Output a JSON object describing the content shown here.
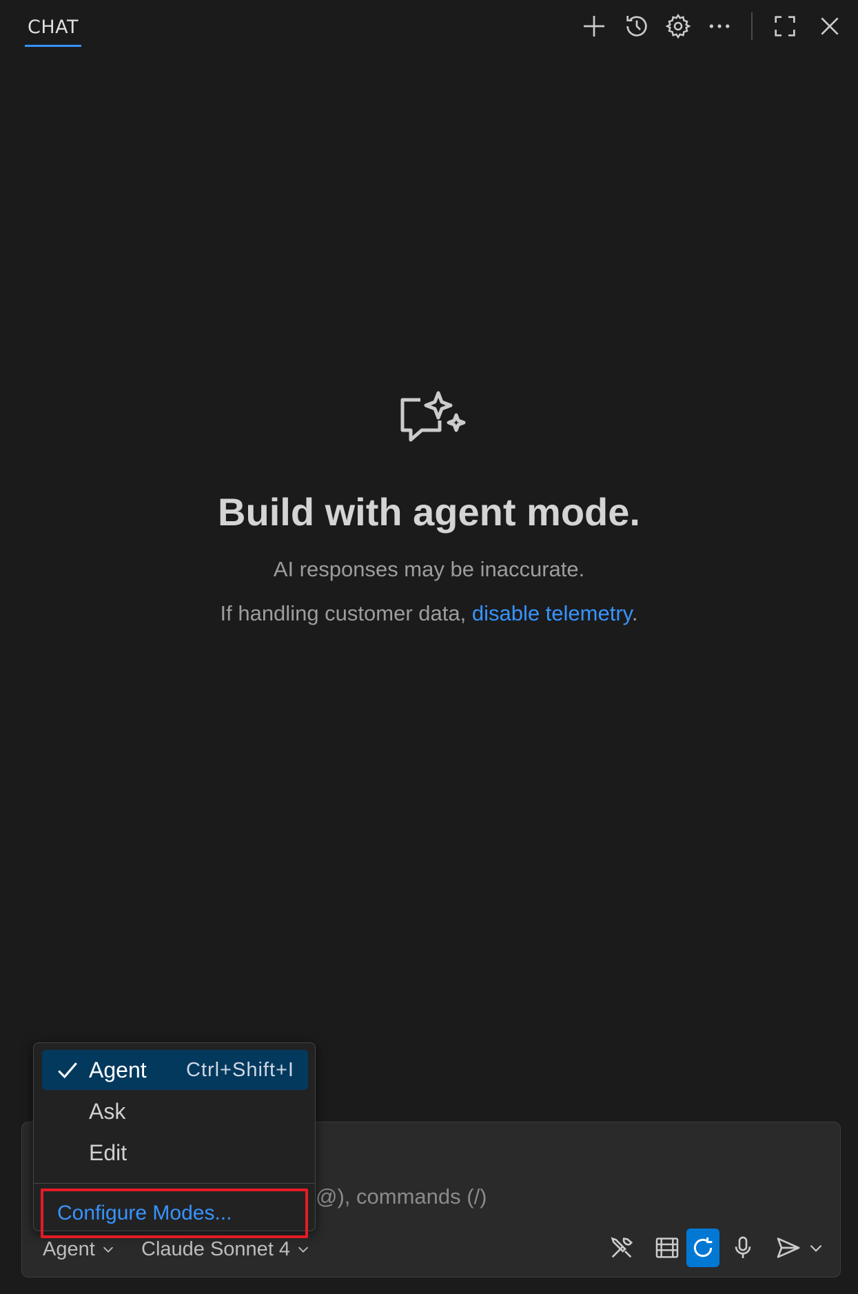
{
  "header": {
    "tab_label": "CHAT",
    "actions": [
      "plus-icon",
      "history-icon",
      "gear-icon",
      "more-icon",
      "maximize-icon",
      "close-icon"
    ]
  },
  "welcome": {
    "title": "Build with agent mode.",
    "subtitle": "AI responses may be inaccurate.",
    "telemetry_prefix": "If handling customer data, ",
    "telemetry_link": "disable telemetry",
    "telemetry_suffix": "."
  },
  "input": {
    "placeholder_visible": "@), commands (/)"
  },
  "toolbar": {
    "mode_picker": "Agent",
    "model_picker": "Claude Sonnet 4",
    "icons": [
      "tools-icon",
      "context-icon",
      "refresh-icon",
      "microphone-icon",
      "send-icon",
      "chevron-down-icon"
    ]
  },
  "mode_menu": {
    "items": [
      {
        "label": "Agent",
        "shortcut": "Ctrl+Shift+I",
        "selected": true
      },
      {
        "label": "Ask",
        "shortcut": "",
        "selected": false
      },
      {
        "label": "Edit",
        "shortcut": "",
        "selected": false
      }
    ],
    "configure": "Configure Modes..."
  },
  "colors": {
    "background": "#1b1b1c",
    "accent": "#3794ff",
    "selected": "#04395e",
    "highlight_border": "#e51b24"
  }
}
